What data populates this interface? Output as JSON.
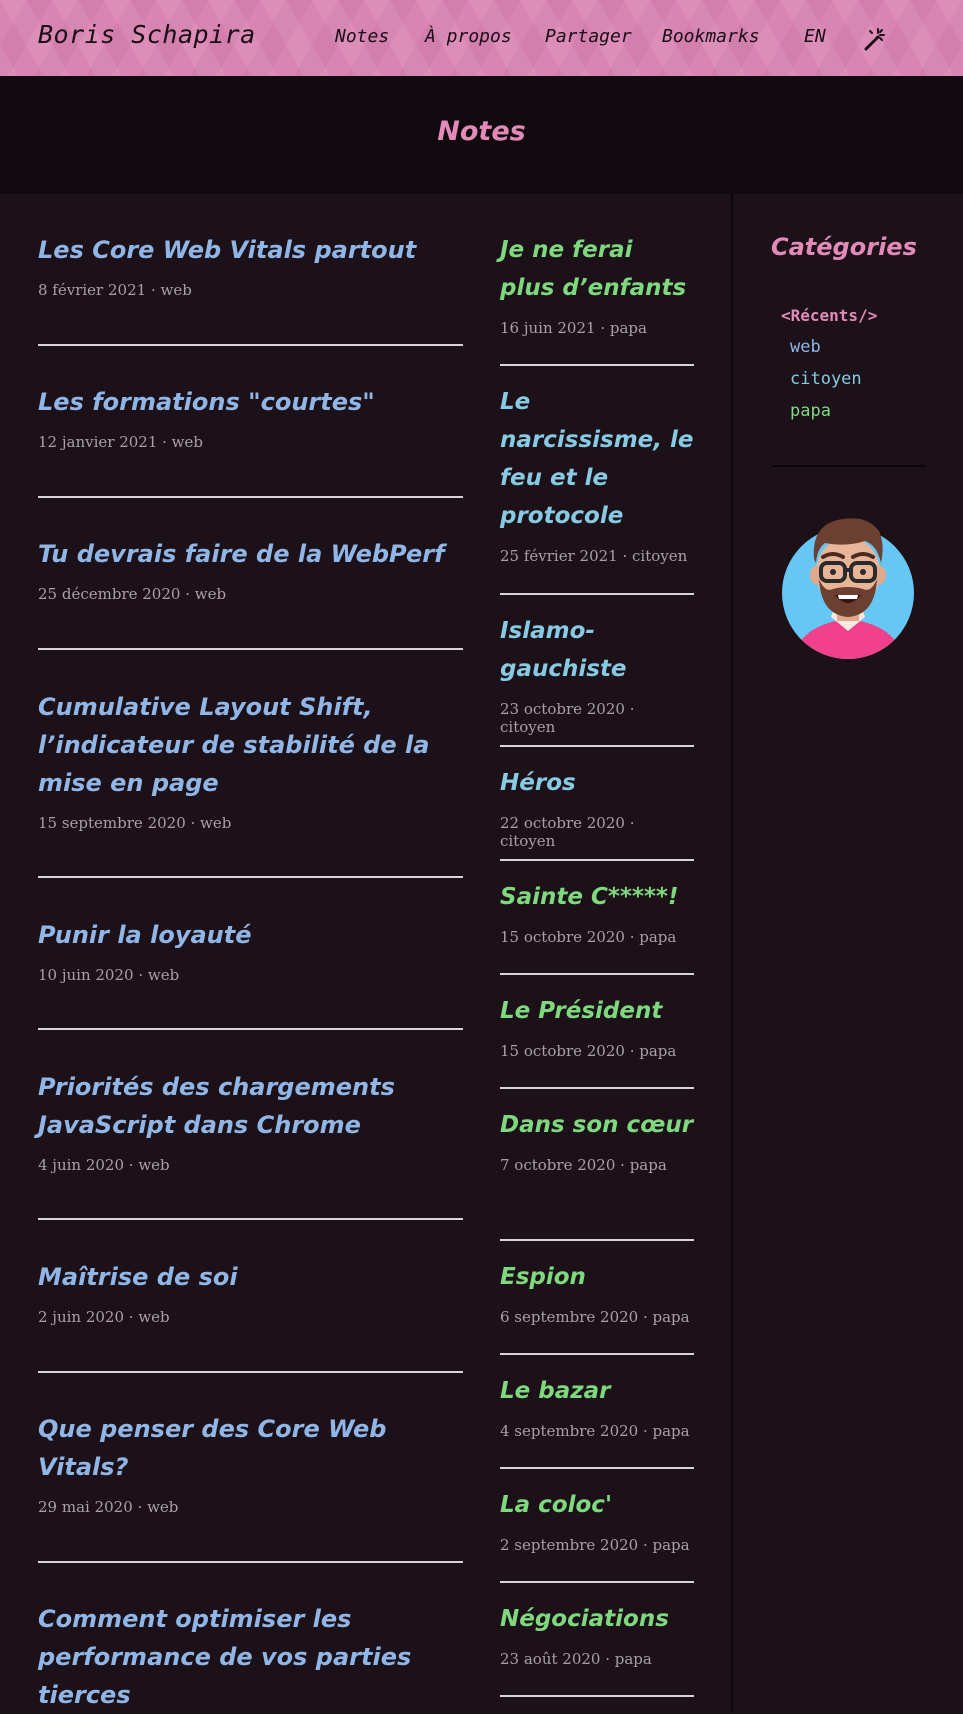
{
  "header": {
    "brand": "Boris Schapira",
    "nav": [
      "Notes",
      "À propos",
      "Partager",
      "Bookmarks",
      "EN"
    ],
    "theme_toggle_icon": "magic-wand-icon"
  },
  "hero": {
    "title": "Notes"
  },
  "left_posts": [
    {
      "title": "Les Core Web Vitals partout",
      "meta": "8 février 2021 · web"
    },
    {
      "title": "Les formations \"courtes\"",
      "meta": "12 janvier 2021 · web"
    },
    {
      "title": "Tu devrais faire de la WebPerf",
      "meta": "25 décembre 2020 · web"
    },
    {
      "title": "Cumulative Layout Shift, l’indicateur de stabilité de la mise en page",
      "meta": "15 septembre 2020 · web"
    },
    {
      "title": "Punir la loyauté",
      "meta": "10 juin 2020 · web"
    },
    {
      "title": "Priorités des chargements JavaScript dans Chrome",
      "meta": "4 juin 2020 · web"
    },
    {
      "title": "Maîtrise de soi",
      "meta": "2 juin 2020 · web"
    },
    {
      "title": "Que penser des Core Web Vitals?",
      "meta": "29 mai 2020 · web"
    },
    {
      "title": "Comment optimiser les performance de vos parties tierces",
      "meta": ""
    }
  ],
  "right_posts": [
    {
      "title": "Je ne ferai plus d’enfants",
      "meta": "16 juin 2021 · papa"
    },
    {
      "title": "Le narcissisme, le feu et le protocole",
      "meta": "25 février 2021 · citoyen"
    },
    {
      "title": "Islamo-gauchiste",
      "meta": "23 octobre 2020 · citoyen"
    },
    {
      "title": "Héros",
      "meta": "22 octobre 2020 · citoyen"
    },
    {
      "title": "Sainte C*****!",
      "meta": "15 octobre 2020 · papa"
    },
    {
      "title": "Le Président",
      "meta": "15 octobre 2020 · papa"
    },
    {
      "title": "Dans son cœur",
      "meta": "7 octobre 2020 · papa"
    },
    {
      "title": "Espion",
      "meta": "6 septembre 2020 · papa"
    },
    {
      "title": "Le bazar",
      "meta": "4 septembre 2020 · papa"
    },
    {
      "title": "La coloc'",
      "meta": "2 septembre 2020 · papa"
    },
    {
      "title": "Négociations",
      "meta": "23 août 2020 · papa"
    }
  ],
  "sidebar": {
    "title": "Catégories",
    "categories": [
      "<Récents/>",
      "web",
      "citoyen",
      "papa"
    ],
    "avatar_icon": "avatar-illustration"
  },
  "colors": {
    "header_bg": "#d985b4",
    "accent_pink": "#e38ab9",
    "web_blue": "#8fb6e6",
    "citoyen_cyan": "#86cbe3",
    "papa_green": "#7ed97e",
    "page_bg": "#1d1119"
  }
}
